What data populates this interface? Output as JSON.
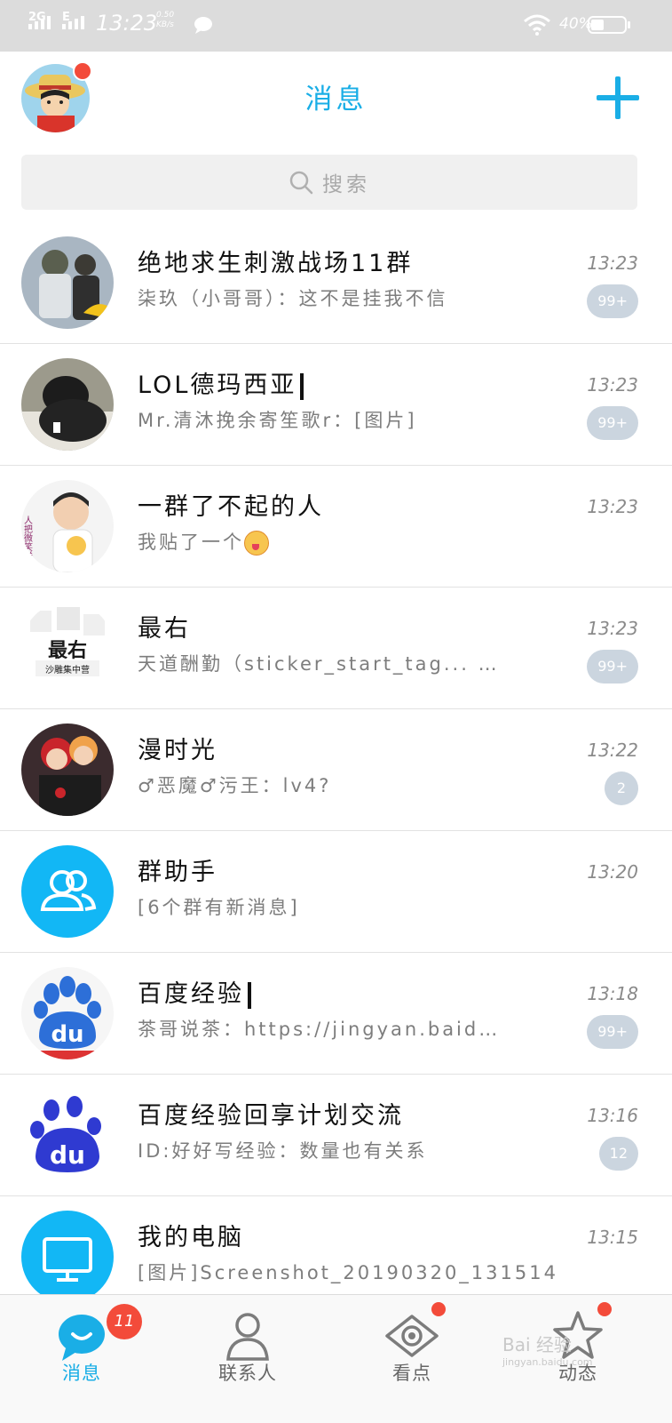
{
  "status_bar": {
    "network_1": "2G",
    "network_2": "E",
    "time": "13:23",
    "speed_value": "0.50",
    "speed_unit": "KB/s",
    "battery": "40%"
  },
  "header": {
    "title": "消息"
  },
  "search": {
    "placeholder": "搜索"
  },
  "chats": [
    {
      "name": "绝地求生刺激战场11群",
      "preview": "柒玖（小哥哥）：这不是挂我不信",
      "time": "13:23",
      "badge": "99+"
    },
    {
      "name": "LOL德玛西亚",
      "preview": "Mr.清沐挽余寄笙歌r：[图片]",
      "time": "13:23",
      "badge": "99+"
    },
    {
      "name": "一群了不起的人",
      "preview": "我贴了一个",
      "time": "13:23",
      "badge": ""
    },
    {
      "name": "最右",
      "preview": "天道酬勤（sticker_start_tag... …",
      "time": "13:23",
      "badge": "99+"
    },
    {
      "name": "漫时光",
      "preview": "♂恶魔♂污王：lv4?",
      "time": "13:22",
      "badge": "2"
    },
    {
      "name": "群助手",
      "preview": "[6个群有新消息]",
      "time": "13:20",
      "badge": ""
    },
    {
      "name": "百度经验",
      "preview": "茶哥说茶：https://jingyan.baid…",
      "time": "13:18",
      "badge": "99+"
    },
    {
      "name": "百度经验回享计划交流",
      "preview": "ID:好好写经验：数量也有关系",
      "time": "13:16",
      "badge": "12"
    },
    {
      "name": "我的电脑",
      "preview": "[图片]Screenshot_20190320_131514.jpg",
      "time": "13:15",
      "badge": ""
    }
  ],
  "avatar_texts": {
    "zuiyou_big": "最右",
    "zuiyou_small": "沙雕集中营",
    "baidu_logo": "du",
    "side_text": "人把微笑送"
  },
  "tabs": [
    {
      "label": "消息",
      "badge": "11",
      "icon": "chat-bubble-icon"
    },
    {
      "label": "联系人",
      "badge": "",
      "icon": "contact-person-icon"
    },
    {
      "label": "看点",
      "badge": "",
      "icon": "eye-icon"
    },
    {
      "label": "动态",
      "badge": "",
      "icon": "star-icon"
    }
  ],
  "watermark": {
    "text": "Bai 经验",
    "url": "jingyan.baidu.com"
  },
  "colors": {
    "accent": "#1aaee6",
    "badge_grey": "#cbd5df",
    "alert_red": "#f34b3a",
    "statusbar_bg": "#dcdcdc"
  }
}
